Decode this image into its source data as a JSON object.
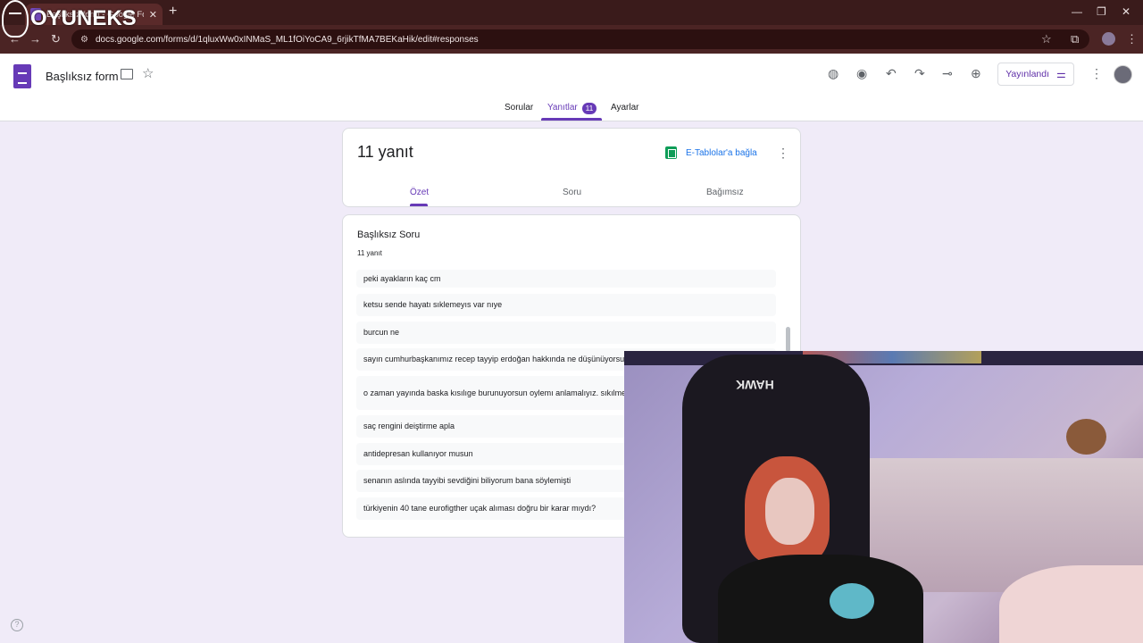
{
  "browser": {
    "tab_title": "Başlıksız form - Google Formlar",
    "tab_close": "✕",
    "new_tab": "+",
    "url": "docs.google.com/forms/d/1qluxWw0xINMaS_ML1fOiYoCA9_6rjikTfMA7BEKaHik/edit#responses",
    "back": "←",
    "forward": "→",
    "reload": "↻",
    "minimize": "—",
    "restore": "❐",
    "close": "✕",
    "bookmark": "☆",
    "extensions": "⧉",
    "menu": "⋮"
  },
  "watermark": {
    "text": "OYUNEKS"
  },
  "header": {
    "form_title": "Başlıksız form",
    "star": "☆",
    "icons": {
      "palette": "◍",
      "preview": "◉",
      "undo": "↶",
      "redo": "↷",
      "link": "⊸",
      "add_collab": "⊕"
    },
    "publish_label": "Yayınlandı",
    "tune": "⚌",
    "more": "⋮"
  },
  "tabs": {
    "questions": "Sorular",
    "responses": "Yanıtlar",
    "responses_count": "11",
    "settings": "Ayarlar"
  },
  "summary_card": {
    "count_title": "11 yanıt",
    "sheets_link": "E-Tablolar'a bağla",
    "more": "⋮",
    "subtabs": {
      "summary": "Özet",
      "question": "Soru",
      "individual": "Bağımsız"
    }
  },
  "question_card": {
    "title": "Başlıksız Soru",
    "count": "11 yanıt",
    "responses": [
      "peki ayakların kaç cm",
      "ketsu sende hayatı sıklemeyıs var nıye",
      "burcun ne",
      "sayın cumhurbaşkanımız recep tayyip erdoğan hakkında ne düşünüyorsun",
      "o zaman yayında baska kısılıge burunuyorsun oylemı anlamalıyız. sıkılmedıysen kendını",
      "saç rengini deiştirme apla",
      "antidepresan kullanıyor musun",
      "senanın aslında tayyibi sevdiğini biliyorum bana söylemişti",
      "türkiyenin 40 tane eurofigther uçak alıması doğru bir karar mıydı?"
    ]
  },
  "help": "?",
  "webcam": {
    "chair_brand": "HAWK"
  }
}
